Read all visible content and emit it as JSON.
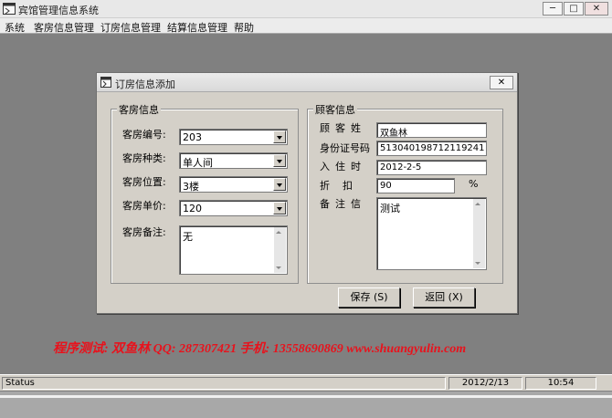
{
  "window": {
    "title": "宾馆管理信息系统",
    "buttons": {
      "minimize": "─",
      "maximize": "□",
      "close": "✕"
    }
  },
  "menu": [
    "系统",
    "客房信息管理",
    "订房信息管理",
    "结算信息管理",
    "帮助"
  ],
  "dialog": {
    "title": "订房信息添加",
    "close": "✕",
    "room_group": {
      "title": "客房信息",
      "fields": [
        {
          "label": "客房编号:",
          "value": "203"
        },
        {
          "label": "客房种类:",
          "value": "单人间"
        },
        {
          "label": "客房位置:",
          "value": "3楼"
        },
        {
          "label": "客房单价:",
          "value": "120"
        }
      ],
      "note_label": "客房备注:",
      "note_value": "无"
    },
    "guest_group": {
      "title": "顾客信息",
      "name_label": "顾客姓",
      "name_value": "双鱼林",
      "id_label": "身份证号码",
      "id_value": "513040198712119241",
      "checkin_label": "入住时",
      "checkin_value": "2012-2-5",
      "discount_label": "折扣",
      "discount_value": "90",
      "percent": "%",
      "note_label": "备注信",
      "note_value": "测试"
    },
    "save_button": "保存 (S)",
    "back_button": "返回 (X)"
  },
  "watermark": "程序测试: 双鱼林   QQ: 287307421   手机: 13558690869   www.shuangyulin.com",
  "statusbar": {
    "status": "Status",
    "date": "2012/2/13",
    "time": "10:54"
  },
  "colors": {
    "desktop": "#808080",
    "dialog": "#d4d0c8",
    "watermark": "#e8121c"
  }
}
